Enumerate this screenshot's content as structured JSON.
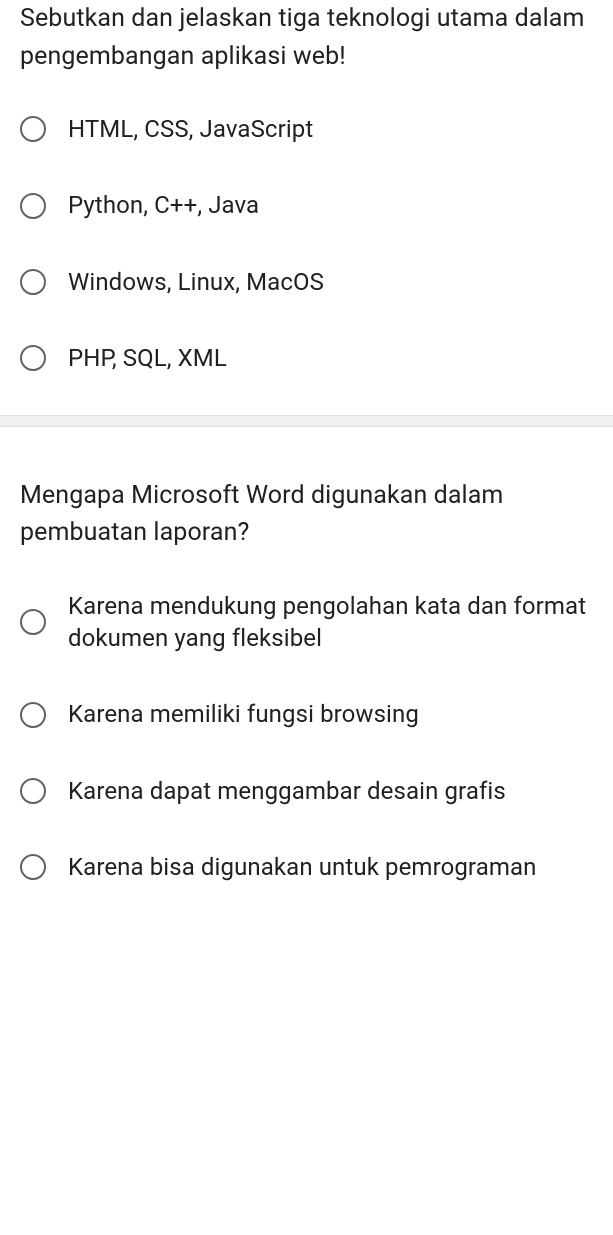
{
  "questions": [
    {
      "text": "Sebutkan dan jelaskan tiga teknologi utama dalam pengembangan aplikasi web!",
      "options": [
        "HTML, CSS, JavaScript",
        "Python, C++, Java",
        "Windows, Linux, MacOS",
        "PHP, SQL, XML"
      ]
    },
    {
      "text": "Mengapa Microsoft Word digunakan dalam pembuatan laporan?",
      "options": [
        "Karena mendukung pengolahan kata dan format dokumen yang fleksibel",
        "Karena memiliki fungsi browsing",
        "Karena dapat menggambar desain grafis",
        "Karena bisa digunakan untuk pemrograman"
      ]
    }
  ]
}
